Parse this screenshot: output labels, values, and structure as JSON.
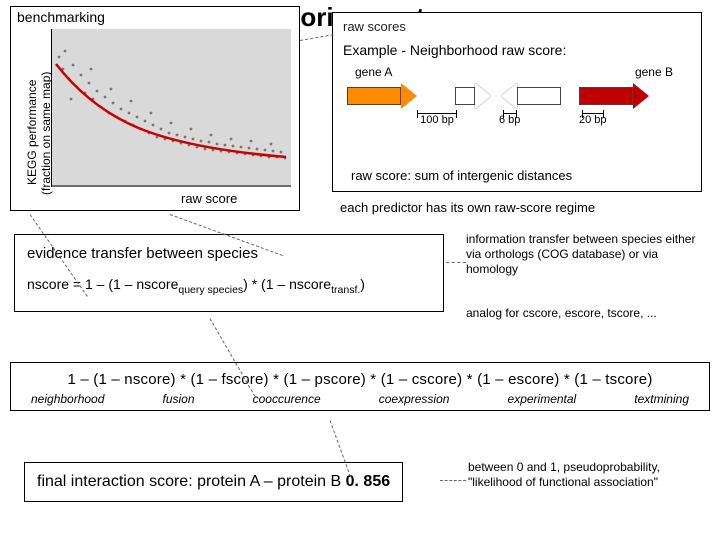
{
  "title": "The scoring system",
  "benchmarking_label": "benchmarking",
  "ylabel1": "KEGG performance",
  "ylabel2": "(fraction on same map)",
  "xlabel": "raw score",
  "raw_scores_box_label": "raw scores",
  "example_caption": "Example - Neighborhood raw score:",
  "gene_a_label": "gene A",
  "gene_b_label": "gene B",
  "dist1": "100 bp",
  "dist2": "6 bp",
  "dist3": "20 bp",
  "raw_score_def": "raw score: sum of intergenic distances",
  "regime_note": "each predictor has its own raw-score regime",
  "transfer_title": "evidence transfer between species",
  "transfer_formula_prefix": "nscore = 1 – (1 – nscore",
  "transfer_formula_sub1": "query species",
  "transfer_formula_mid": ") * (1 – nscore",
  "transfer_formula_sub2": "transf.",
  "transfer_formula_suffix": ")",
  "info_transfer_note": "information transfer between species either via orthologs (COG database) or via homology",
  "analog_note": "analog for cscore, escore, tscore, ...",
  "combined_formula": "1 – (1 – nscore) * (1 – fscore) * (1 – pscore) * (1 – cscore) * (1 – escore) * (1 – tscore)",
  "labels": {
    "n": "neighborhood",
    "f": "fusion",
    "p": "cooccurence",
    "c": "coexpression",
    "e": "experimental",
    "t": "textmining"
  },
  "final_prefix": "final interaction score: protein A – protein B  ",
  "final_value": "0. 856",
  "final_note": "between 0 and 1, pseudoprobability, \"likelihood of functional association\"",
  "chart_data": {
    "type": "scatter+line",
    "title": "benchmarking",
    "xlabel": "raw score",
    "ylabel": "KEGG performance (fraction on same map)",
    "xlim": [
      0,
      1
    ],
    "ylim": [
      0,
      1
    ],
    "fit_line": {
      "name": "red fit",
      "color": "#cc0000",
      "x": [
        0.02,
        0.1,
        0.2,
        0.3,
        0.4,
        0.5,
        0.6,
        0.7,
        0.8,
        0.9,
        0.98
      ],
      "y": [
        0.78,
        0.56,
        0.42,
        0.34,
        0.29,
        0.26,
        0.24,
        0.22,
        0.21,
        0.2,
        0.19
      ]
    },
    "scatter_notes": "dense cloud of ~200 grey points following the decaying fit line with vertical spread ±0.08"
  }
}
